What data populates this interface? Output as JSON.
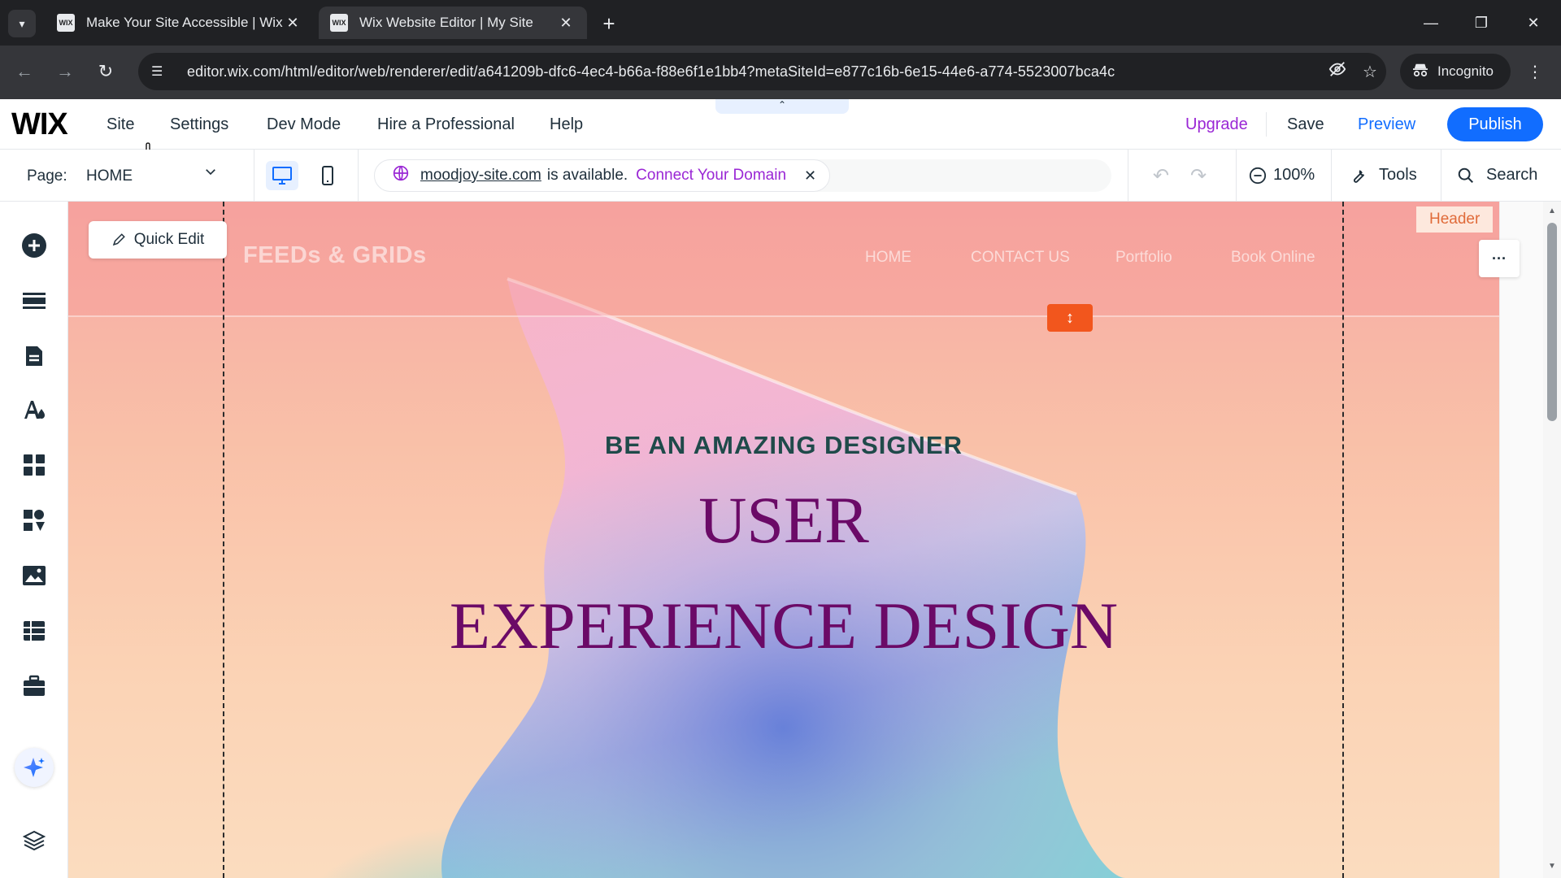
{
  "browser": {
    "tabs": [
      {
        "title": "Make Your Site Accessible | Wix",
        "favicon": "WIX",
        "active": false
      },
      {
        "title": "Wix Website Editor | My Site",
        "favicon": "WIX",
        "active": true
      }
    ],
    "url": "editor.wix.com/html/editor/web/renderer/edit/a641209b-dfc6-4ec4-b66a-f88e6f1e1bb4?metaSiteId=e877c16b-6e15-44e6-a774-5523007bca4c",
    "profile_label": "Incognito"
  },
  "wix_topbar": {
    "logo": "WIX",
    "menu": [
      "Site",
      "Settings",
      "Dev Mode",
      "Hire a Professional",
      "Help"
    ],
    "upgrade": "Upgrade",
    "save": "Save",
    "preview": "Preview",
    "publish": "Publish"
  },
  "pagebar": {
    "page_label": "Page:",
    "page_name": "HOME",
    "domain": "moodjoy-site.com",
    "domain_status": "is available.",
    "connect_label": "Connect Your Domain",
    "zoom": "100%",
    "tools": "Tools",
    "search": "Search"
  },
  "sidebar": {
    "items": [
      "add-elements",
      "add-section",
      "pages",
      "site-design",
      "add-apps",
      "business-apps",
      "media",
      "cms",
      "portfolio",
      "ai-assistant",
      "layers"
    ]
  },
  "canvas": {
    "quick_edit": "Quick Edit",
    "header_tag": "Header",
    "more_label": "···",
    "site": {
      "brand": "FEEDs & GRIDs",
      "nav": [
        "HOME",
        "CONTACT US",
        "Portfolio",
        "Book Online"
      ],
      "kicker": "BE AN AMAZING DESIGNER",
      "headline_line1": "USER",
      "headline_line2": "EXPERIENCE DESIGN"
    }
  },
  "colors": {
    "accent_blue": "#116dff",
    "upgrade_purple": "#9a27d5",
    "handle_orange": "#f2561d",
    "headline_purple": "#6b0a67",
    "kicker_teal": "#1f4a4a"
  }
}
